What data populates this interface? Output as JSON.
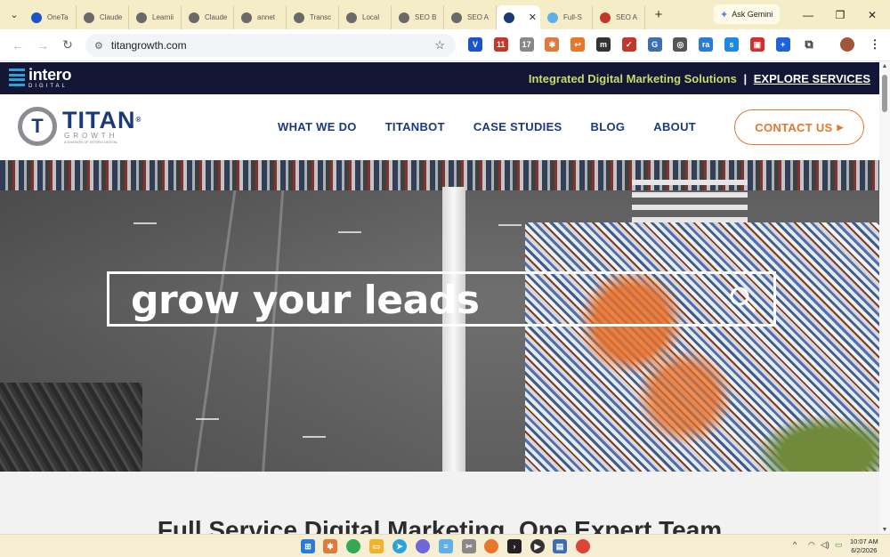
{
  "browser": {
    "tabs": [
      {
        "title": "OneTa",
        "icon": "onetab-icon",
        "color": "#1b54c9"
      },
      {
        "title": "Claude",
        "icon": "globe-icon",
        "color": "#6a6a6a"
      },
      {
        "title": "Learnii",
        "icon": "globe-icon",
        "color": "#6a6a6a"
      },
      {
        "title": "Claude",
        "icon": "globe-icon",
        "color": "#6a6a6a"
      },
      {
        "title": "annet",
        "icon": "globe-icon",
        "color": "#6a6a6a"
      },
      {
        "title": "Transc",
        "icon": "globe-icon",
        "color": "#6a6a6a"
      },
      {
        "title": "Local",
        "icon": "globe-icon",
        "color": "#6a6a6a"
      },
      {
        "title": "SEO B",
        "icon": "globe-icon",
        "color": "#6a6a6a"
      },
      {
        "title": "SEO A",
        "icon": "globe-icon",
        "color": "#6a6a6a"
      },
      {
        "title": "",
        "icon": "titan-icon",
        "color": "#1b3a7a",
        "active": true
      },
      {
        "title": "Full-S",
        "icon": "chart-icon",
        "color": "#5fb0e8"
      },
      {
        "title": "SEO A",
        "icon": "m-icon",
        "color": "#c0392b"
      }
    ],
    "gemini_label": "Ask Gemini",
    "url": "titangrowth.com",
    "extensions": [
      "V",
      "11",
      "17",
      "✱",
      "↩",
      "m",
      "✓",
      "G",
      "◎",
      "ra",
      "s",
      "▣",
      "+"
    ]
  },
  "site": {
    "topbar": {
      "logo_text": "intero",
      "logo_sub": "DIGITAL",
      "tagline": "Integrated Digital Marketing Solutions",
      "separator": "|",
      "cta": "EXPLORE SERVICES"
    },
    "logo": {
      "mark": "T",
      "name": "TITAN",
      "registered": "®",
      "sub": "GROWTH",
      "division": "A DIVISION OF INTERO DIGITAL"
    },
    "nav": [
      "WHAT WE DO",
      "TITANBOT",
      "CASE STUDIES",
      "BLOG",
      "ABOUT"
    ],
    "contact_label": "CONTACT US",
    "hero": {
      "search_text": "grow your leads"
    },
    "section_title": "Full Service Digital Marketing. One Expert Team"
  },
  "taskbar": {
    "time": "10:07 AM",
    "date": "6/2/2026"
  }
}
